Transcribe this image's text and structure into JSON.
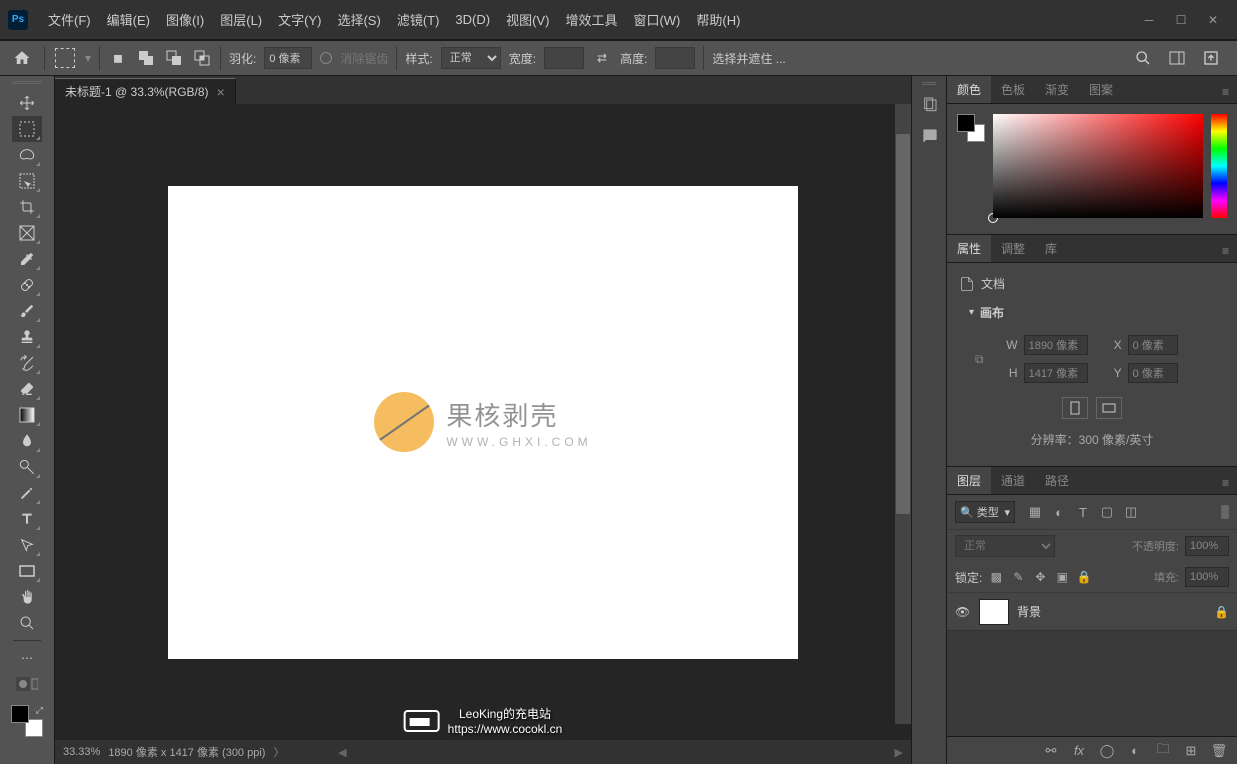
{
  "menu": {
    "file": "文件(F)",
    "edit": "编辑(E)",
    "image": "图像(I)",
    "layer": "图层(L)",
    "type": "文字(Y)",
    "select": "选择(S)",
    "filter": "滤镜(T)",
    "threeD": "3D(D)",
    "view": "视图(V)",
    "plugin": "增效工具",
    "window": "窗口(W)",
    "help": "帮助(H)"
  },
  "options": {
    "feather_label": "羽化:",
    "feather_value": "0 像素",
    "antialias": "消除锯齿",
    "style_label": "样式:",
    "style_value": "正常",
    "width_label": "宽度:",
    "height_label": "高度:",
    "mask_label": "选择并遮住 ..."
  },
  "tab": {
    "title": "未标题-1 @ 33.3%(RGB/8)"
  },
  "watermark": {
    "title": "果核剥壳",
    "url": "WWW.GHXI.COM"
  },
  "status": {
    "zoom": "33.33%",
    "dims": "1890 像素 x 1417 像素 (300 ppi)"
  },
  "footer": {
    "line1": "LeoKing的充电站",
    "line2": "https://www.cocokl.cn"
  },
  "panels": {
    "color": {
      "tab1": "颜色",
      "tab2": "色板",
      "tab3": "渐变",
      "tab4": "图案"
    },
    "props": {
      "tab1": "属性",
      "tab2": "调整",
      "tab3": "库",
      "doc": "文档",
      "canvas": "画布",
      "w_lbl": "W",
      "w_val": "1890 像素",
      "x_lbl": "X",
      "x_val": "0 像素",
      "h_lbl": "H",
      "h_val": "1417 像素",
      "y_lbl": "Y",
      "y_val": "0 像素",
      "resolution": "分辨率：300 像素/英寸"
    },
    "layers": {
      "tab1": "图层",
      "tab2": "通道",
      "tab3": "路径",
      "filter": "类型",
      "blend": "正常",
      "opacity_lbl": "不透明度:",
      "opacity_val": "100%",
      "lock_lbl": "锁定:",
      "fill_lbl": "填充:",
      "fill_val": "100%",
      "layer_name": "背景"
    }
  }
}
